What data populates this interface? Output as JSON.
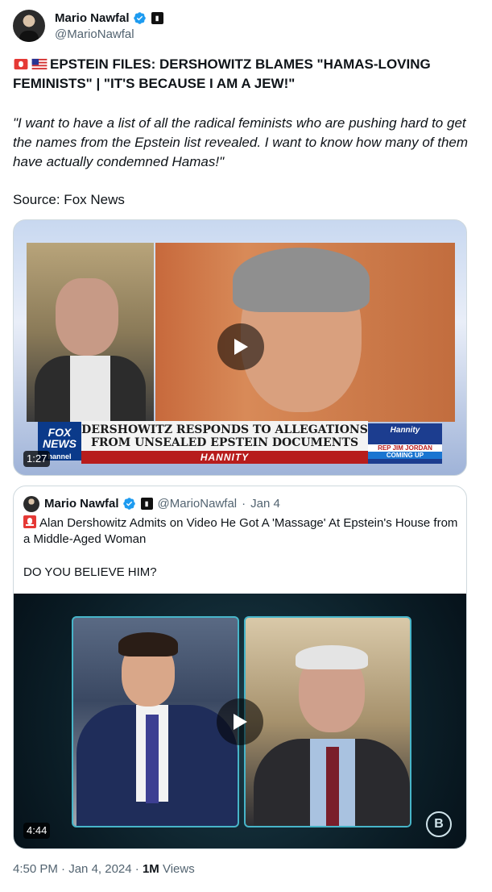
{
  "author": {
    "display_name": "Mario Nawfal",
    "handle": "@MarioNawfal",
    "affiliate_badge": "square-logo-badge"
  },
  "tweet": {
    "headline": "EPSTEIN FILES:  DERSHOWITZ BLAMES \"HAMAS-LOVING FEMINISTS\"  | \"IT'S BECAUSE I AM A JEW!\"",
    "quote": "\"I want to have a list of all the radical feminists who are pushing hard to get the names from the Epstein list revealed.  I want to know how many of them have actually condemned Hamas!\"",
    "source": "Source: Fox News",
    "emojis": [
      "siren-icon",
      "us-flag-icon"
    ]
  },
  "video1": {
    "duration": "1:27",
    "banner_line1": "DERSHOWITZ RESPONDS TO ALLEGATIONS",
    "banner_line2": "FROM UNSEALED EPSTEIN DOCUMENTS",
    "show": "HANNITY",
    "network_line1": "FOX",
    "network_line2": "NEWS",
    "network_line3": "hannel",
    "promo_show": "Hannity",
    "promo_guest": "REP JIM JORDAN",
    "promo_status": "COMING UP"
  },
  "quoted_tweet": {
    "display_name": "Mario Nawfal",
    "handle": "@MarioNawfal",
    "date": "Jan 4",
    "separator": "·",
    "text": "Alan Dershowitz Admits on Video He Got A 'Massage' At Epstein's House from a Middle-Aged Woman",
    "text2": "DO YOU BELIEVE HIM?",
    "video": {
      "duration": "4:44",
      "channel_logo": "B"
    }
  },
  "footer": {
    "time": "4:50 PM",
    "separator": "·",
    "date": "Jan 4, 2024",
    "views_count": "1M",
    "views_label": "Views"
  },
  "colors": {
    "verified": "#1d9bf0",
    "text": "#0f1419",
    "secondary": "#536471",
    "border": "#cfd9de"
  }
}
